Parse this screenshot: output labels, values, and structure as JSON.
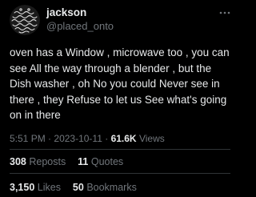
{
  "author": {
    "display_name": "jackson",
    "handle": "@placed_onto"
  },
  "tweet": {
    "text": "oven has a Window , microwave too , you can\nsee All the way through a blender , but the\nDish washer , oh No you could Never see in\nthere , they Refuse to let us See what's going\non in there",
    "time": "5:51 PM",
    "date": "2023-10-11",
    "separator": "·",
    "views_count": "61.6K",
    "views_label": "Views"
  },
  "stats": {
    "reposts_count": "308",
    "reposts_label": "Reposts",
    "quotes_count": "11",
    "quotes_label": "Quotes",
    "likes_count": "3,150",
    "likes_label": "Likes",
    "bookmarks_count": "50",
    "bookmarks_label": "Bookmarks"
  },
  "icons": {
    "more": "more-options-icon",
    "avatar": "avatar-pattern"
  },
  "colors": {
    "background": "#000000",
    "text_primary": "#e7e9ea",
    "text_secondary": "#71767b",
    "divider": "#2f3336"
  }
}
